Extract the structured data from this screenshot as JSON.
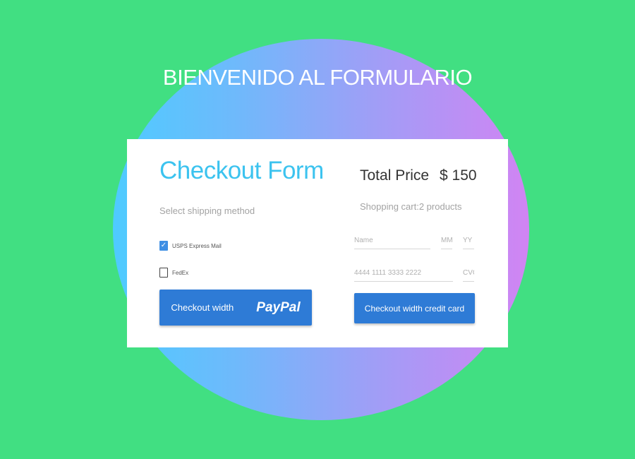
{
  "welcome": "BIENVENIDO AL FORMULARIO",
  "form": {
    "title": "Checkout Form",
    "shipping_label": "Select shipping method",
    "options": [
      {
        "label": "USPS Express Mail",
        "checked": true
      },
      {
        "label": "FedEx",
        "checked": false
      }
    ],
    "paypal_button": {
      "text": "Checkout width",
      "logo": "PayPal"
    }
  },
  "summary": {
    "total_label": "Total Price",
    "total_value": "$ 150",
    "cart_label": "Shopping cart:2 products"
  },
  "payment": {
    "name_placeholder": "Name",
    "mm_placeholder": "MM",
    "yy_placeholder": "YY",
    "card_placeholder": "4444 1111 3333 2222",
    "cvc_placeholder": "CVC",
    "card_button": "Checkout width credit card"
  },
  "colors": {
    "background": "#41df82",
    "title_accent": "#3cc3ef",
    "button": "#2e7bd6",
    "checkbox": "#3f8fe4"
  }
}
